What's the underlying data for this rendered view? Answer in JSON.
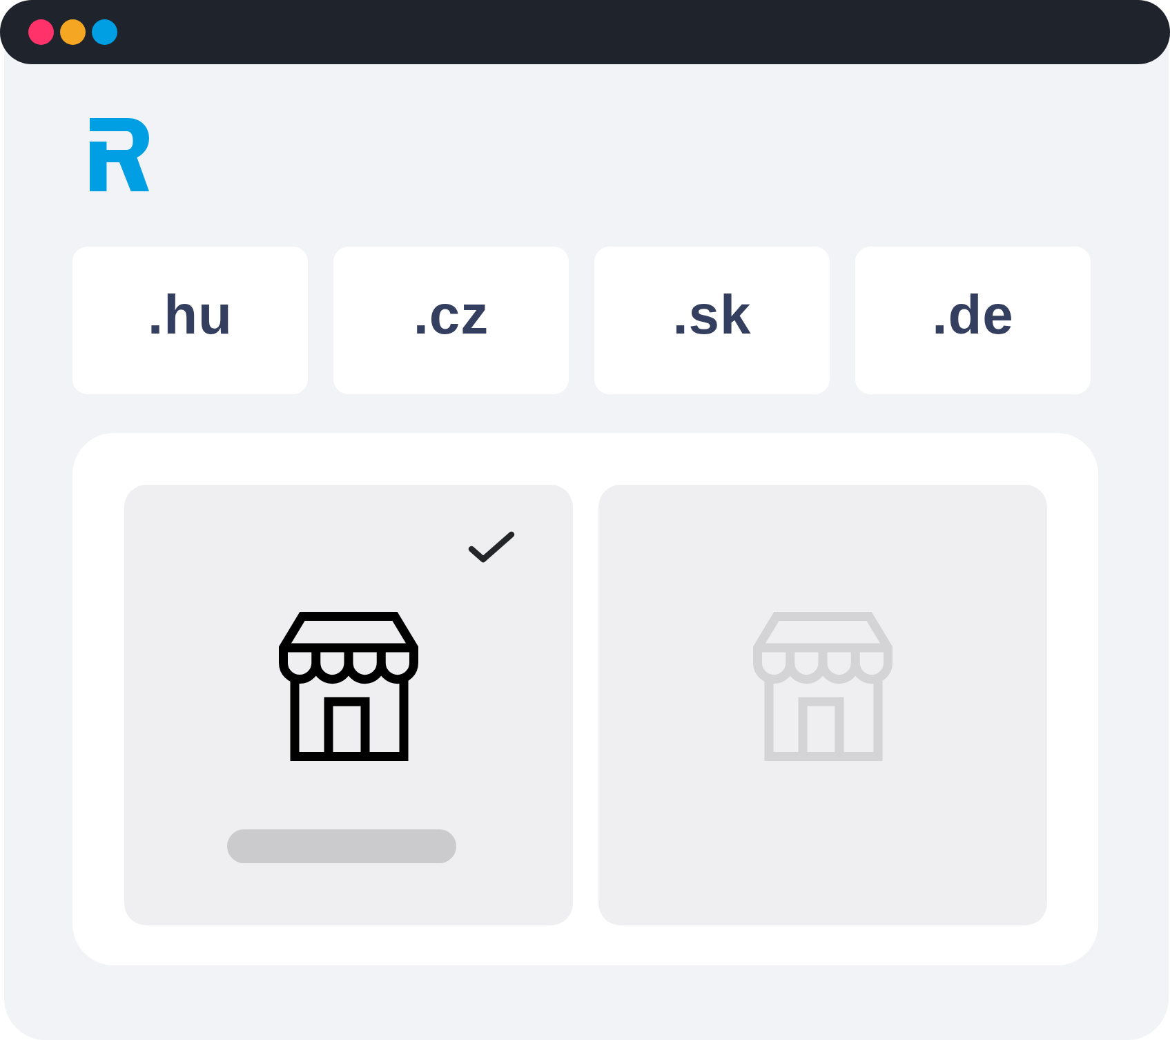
{
  "window": {
    "controls": [
      {
        "color": "#ff3369"
      },
      {
        "color": "#f5a623"
      },
      {
        "color": "#009fe3"
      }
    ]
  },
  "domains": [
    ".hu",
    ".cz",
    ".sk",
    ".de"
  ],
  "shop_options": [
    {
      "selected": true
    },
    {
      "selected": false
    }
  ]
}
